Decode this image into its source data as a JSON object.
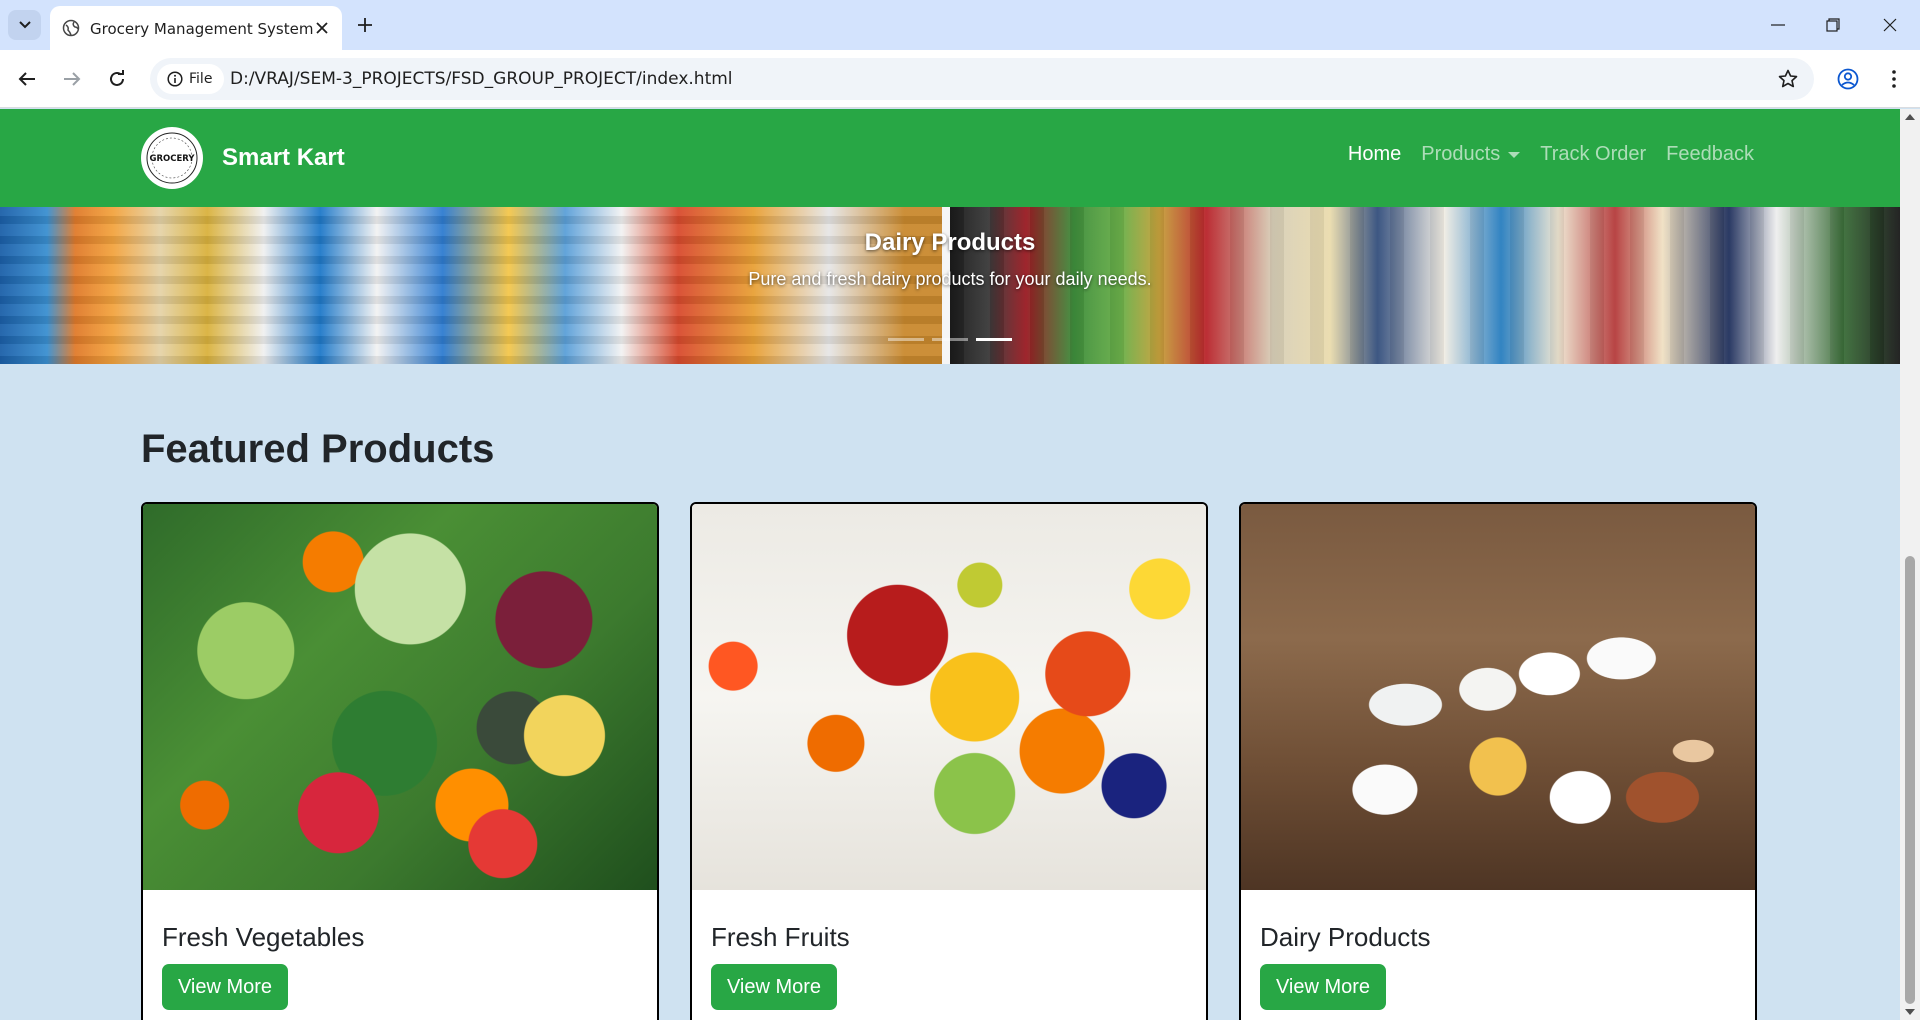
{
  "browser": {
    "tab_title": "Grocery Management System",
    "site_chip_label": "File",
    "url": "D:/VRAJ/SEM-3_PROJECTS/FSD_GROUP_PROJECT/index.html"
  },
  "navbar": {
    "brand": "Smart Kart",
    "logo_text": "GROCERY",
    "links": [
      {
        "label": "Home",
        "active": true
      },
      {
        "label": "Products",
        "dropdown": true
      },
      {
        "label": "Track Order"
      },
      {
        "label": "Feedback"
      }
    ],
    "background_color": "#28a745"
  },
  "carousel": {
    "active_caption": {
      "title": "Dairy Products",
      "text": "Pure and fresh dairy products for your daily needs."
    },
    "indicator_count": 3,
    "active_indicator": 3
  },
  "featured": {
    "heading": "Featured Products",
    "cards": [
      {
        "title": "Fresh Vegetables",
        "button": "View More"
      },
      {
        "title": "Fresh Fruits",
        "button": "View More"
      },
      {
        "title": "Dairy Products",
        "button": "View More"
      }
    ]
  },
  "colors": {
    "accent": "#28a745",
    "page_background": "#cfe2f1",
    "tabstrip": "#d3e3fd"
  }
}
